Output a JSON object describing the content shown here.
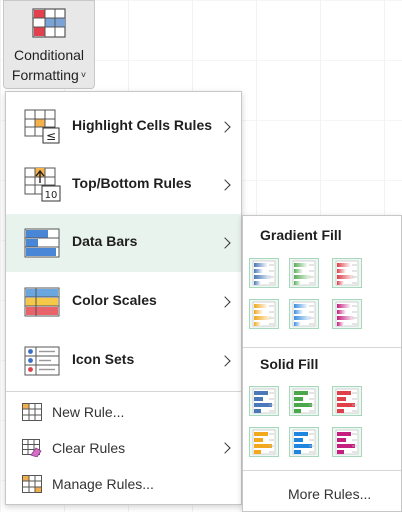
{
  "ribbon": {
    "button_line1": "Conditional",
    "button_line2": "Formatting",
    "chevron": "˅",
    "icon": "conditional-formatting-icon"
  },
  "menu": {
    "items": [
      {
        "label": "Highlight Cells Rules",
        "icon": "highlight-cells-rules-icon",
        "has_submenu": true
      },
      {
        "label": "Top/Bottom Rules",
        "icon": "top-bottom-rules-icon",
        "has_submenu": true
      },
      {
        "label": "Data Bars",
        "icon": "data-bars-icon",
        "has_submenu": true,
        "active": true
      },
      {
        "label": "Color Scales",
        "icon": "color-scales-icon",
        "has_submenu": true
      },
      {
        "label": "Icon Sets",
        "icon": "icon-sets-icon",
        "has_submenu": true
      }
    ],
    "small_items": [
      {
        "label": "New Rule...",
        "icon": "new-rule-icon",
        "has_submenu": false
      },
      {
        "label": "Clear Rules",
        "icon": "clear-rules-icon",
        "has_submenu": true
      },
      {
        "label": "Manage Rules...",
        "icon": "manage-rules-icon",
        "has_submenu": false
      }
    ]
  },
  "submenu": {
    "gradient_title": "Gradient Fill",
    "solid_title": "Solid Fill",
    "gradient_colors": [
      "#4a78b8",
      "#5aae5a",
      "#e0404a",
      "#f2a81d",
      "#3d8fe0",
      "#c41f7e"
    ],
    "solid_colors": [
      "#4a78b8",
      "#4aa84a",
      "#e0404a",
      "#f2a81d",
      "#1f86e0",
      "#c41f7e"
    ],
    "more_rules": "More Rules..."
  }
}
